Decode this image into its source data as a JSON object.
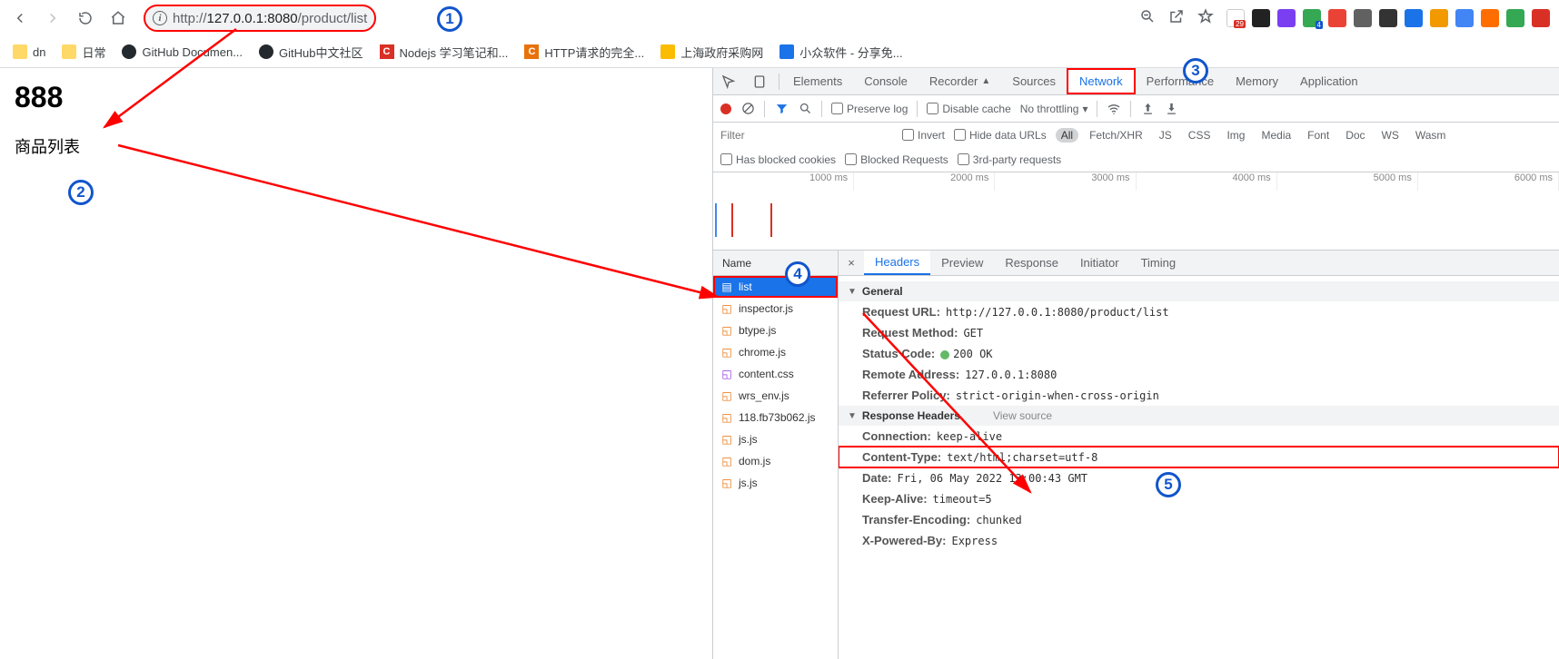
{
  "url": {
    "prefix": "http://",
    "host": "127.0.0.1:8080",
    "path": "/product/list"
  },
  "bookmarks": [
    {
      "label": "dn",
      "type": "folder"
    },
    {
      "label": "日常",
      "type": "folder"
    },
    {
      "label": "GitHub Documen...",
      "type": "github"
    },
    {
      "label": "GitHub中文社区",
      "type": "github"
    },
    {
      "label": "Nodejs 学习笔记和...",
      "type": "c-red"
    },
    {
      "label": "HTTP请求的完全...",
      "type": "c-orange"
    },
    {
      "label": "上海政府采购网",
      "type": "gov"
    },
    {
      "label": "小众软件 - 分享免...",
      "type": "app"
    }
  ],
  "page": {
    "heading": "888",
    "text": "商品列表"
  },
  "devtools": {
    "tabs": [
      "Elements",
      "Console",
      "Recorder",
      "Sources",
      "Network",
      "Performance",
      "Memory",
      "Application"
    ],
    "active_tab": "Network",
    "toolbar": {
      "preserve_log": "Preserve log",
      "disable_cache": "Disable cache",
      "throttling": "No throttling"
    },
    "filter": {
      "placeholder": "Filter",
      "invert": "Invert",
      "hide_urls": "Hide data URLs",
      "types": [
        "All",
        "Fetch/XHR",
        "JS",
        "CSS",
        "Img",
        "Media",
        "Font",
        "Doc",
        "WS",
        "Wasm"
      ],
      "blocked_cookies": "Has blocked cookies",
      "blocked_requests": "Blocked Requests",
      "third_party": "3rd-party requests"
    },
    "timeline_ticks": [
      "1000 ms",
      "2000 ms",
      "3000 ms",
      "4000 ms",
      "5000 ms",
      "6000 ms"
    ],
    "name_col": "Name",
    "requests": [
      {
        "name": "list",
        "type": "doc",
        "selected": true
      },
      {
        "name": "inspector.js",
        "type": "js"
      },
      {
        "name": "btype.js",
        "type": "js"
      },
      {
        "name": "chrome.js",
        "type": "js"
      },
      {
        "name": "content.css",
        "type": "css"
      },
      {
        "name": "wrs_env.js",
        "type": "js"
      },
      {
        "name": "118.fb73b062.js",
        "type": "js"
      },
      {
        "name": "js.js",
        "type": "js"
      },
      {
        "name": "dom.js",
        "type": "js"
      },
      {
        "name": "js.js",
        "type": "js"
      }
    ],
    "detail_tabs": [
      "Headers",
      "Preview",
      "Response",
      "Initiator",
      "Timing"
    ],
    "detail_active": "Headers",
    "headers": {
      "general_title": "General",
      "general": [
        {
          "k": "Request URL:",
          "v": "http://127.0.0.1:8080/product/list"
        },
        {
          "k": "Request Method:",
          "v": "GET"
        },
        {
          "k": "Status Code:",
          "v": "200 OK",
          "status": true
        },
        {
          "k": "Remote Address:",
          "v": "127.0.0.1:8080"
        },
        {
          "k": "Referrer Policy:",
          "v": "strict-origin-when-cross-origin"
        }
      ],
      "response_title": "Response Headers",
      "view_source": "View source",
      "response": [
        {
          "k": "Connection:",
          "v": "keep-alive"
        },
        {
          "k": "Content-Type:",
          "v": "text/html;charset=utf-8",
          "highlight": true
        },
        {
          "k": "Date:",
          "v": "Fri, 06 May 2022 13:00:43 GMT"
        },
        {
          "k": "Keep-Alive:",
          "v": "timeout=5"
        },
        {
          "k": "Transfer-Encoding:",
          "v": "chunked"
        },
        {
          "k": "X-Powered-By:",
          "v": "Express"
        }
      ]
    }
  },
  "annotations": [
    "1",
    "2",
    "3",
    "4",
    "5"
  ],
  "ext_colors": [
    "#d93025",
    "#222",
    "#7b3ff2",
    "#34a853",
    "#ea4335",
    "#616161",
    "#333",
    "#1a73e8",
    "#f29900",
    "#4285f4",
    "#ff6d00",
    "#34a853",
    "#d93025"
  ]
}
